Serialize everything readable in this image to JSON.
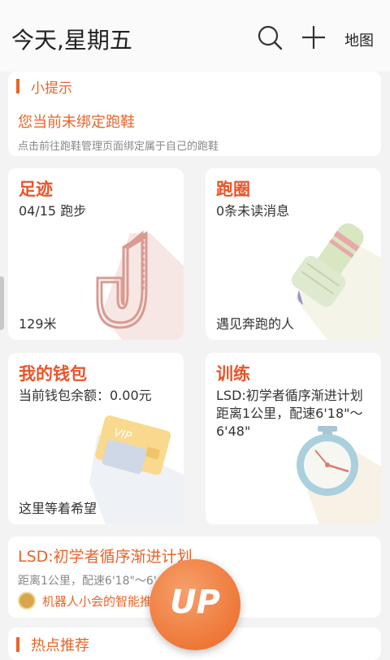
{
  "header": {
    "title": "今天,星期五",
    "search_icon": "search-icon",
    "add_icon": "plus-icon",
    "map_label": "地图"
  },
  "tip": {
    "title": "小提示",
    "main": "您当前未绑定跑鞋",
    "sub": "点击前往跑鞋管理页面绑定属于自己的跑鞋"
  },
  "tiles": [
    {
      "title": "足迹",
      "sub": "04/15 跑步",
      "foot": "129米"
    },
    {
      "title": "跑圈",
      "sub": "0条未读消息",
      "foot": "遇见奔跑的人"
    },
    {
      "title": "我的钱包",
      "sub": "当前钱包余额：0.00元",
      "foot": "这里等着希望"
    },
    {
      "title": "训练",
      "sub": "LSD:初学者循序渐进计划 距离1公里，配速6'18\"～6'48\"",
      "foot": ""
    }
  ],
  "plan": {
    "title": "LSD:初学者循序渐进计划",
    "sub": "距离1公里，配速6'18\"～6'48\"",
    "note": "机器人小会的智能推荐任务"
  },
  "hot": {
    "title": "热点推荐"
  },
  "up_button": {
    "label": "UP"
  },
  "vip_card_text": "VIP",
  "colors": {
    "accent": "#e8652a",
    "title_red": "#e8552a",
    "background": "#f3f3f3"
  }
}
